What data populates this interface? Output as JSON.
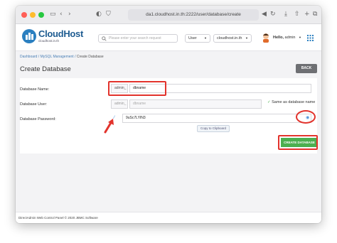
{
  "browser": {
    "url": "da1.cloudhost.in.th:2222/user/database/create",
    "traffic_lights": [
      "#ff5f57",
      "#febc2e",
      "#28c840"
    ]
  },
  "header": {
    "logo_text": "CloudHost",
    "logo_sub": "cloudhost.in.th",
    "search_placeholder": "Please enter your search request",
    "role_select": "User",
    "domain_select": "cloudhost.in.th",
    "greeting": "Hello,",
    "username": "admin"
  },
  "breadcrumb": {
    "items": [
      "Dashboard",
      "MySQL Management"
    ],
    "current": "Create Database",
    "separator": " / "
  },
  "page_title": "Create Database",
  "back_label": "BACK",
  "form": {
    "db_name_label": "Database Name:",
    "db_name_prefix": "admin_",
    "db_name_value": "dbname",
    "db_user_label": "Database User:",
    "db_user_prefix": "admin_",
    "db_user_placeholder": "dbname",
    "same_as_db_label": "Same as database name",
    "db_password_label": "Database Password:",
    "password_value": "9uSc7LYIN3",
    "copy_tooltip": "Copy to Clipboard"
  },
  "create_label": "CREATE DATABASE",
  "footer_text": "DirectAdmin Web Control Panel © 2020 JBMC Software",
  "colors": {
    "annotation_red": "#e2332c",
    "primary_green": "#4caf50",
    "brand_blue": "#1e5c91"
  }
}
